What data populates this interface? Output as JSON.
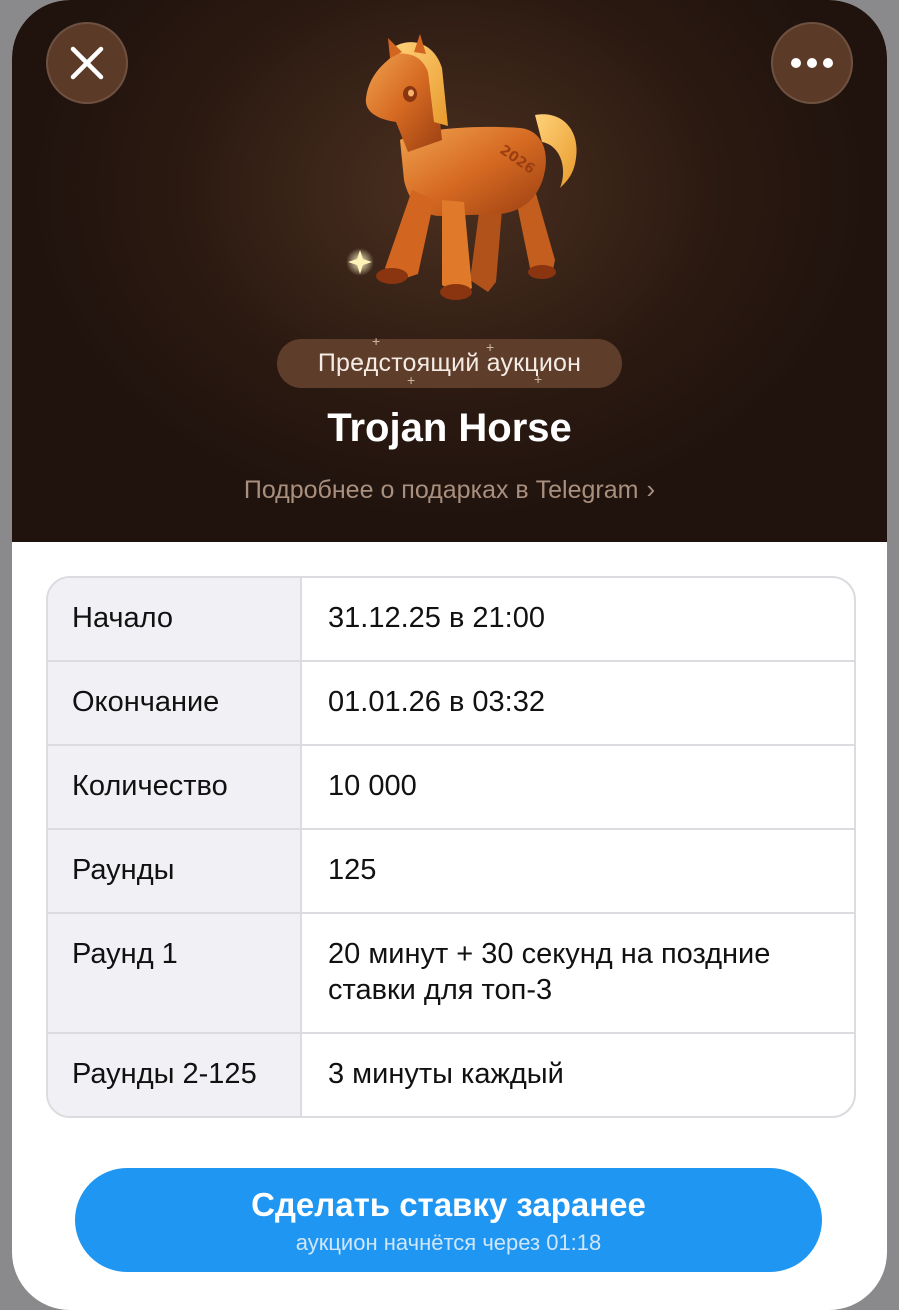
{
  "header": {
    "close_icon": "close-icon",
    "more_icon": "more-dots-icon",
    "gift_image": "trojan-horse-gift",
    "gift_engraving": "2026",
    "badge": "Предстоящий аукцион",
    "title": "Trojan Horse",
    "more_link": "Подробнее о подарках в Telegram",
    "more_link_icon": "chevron-right-icon"
  },
  "auction_details": [
    {
      "label": "Начало",
      "value": "31.12.25 в 21:00"
    },
    {
      "label": "Окончание",
      "value": "01.01.26 в 03:32"
    },
    {
      "label": "Количество",
      "value": "10 000"
    },
    {
      "label": "Раунды",
      "value": "125"
    },
    {
      "label": "Раунд 1",
      "value": "20 минут + 30 секунд на поздние ставки для топ-3"
    },
    {
      "label": "Раунды 2-125",
      "value": "3 минуты каждый"
    }
  ],
  "bid_button": {
    "label": "Сделать ставку заранее",
    "subtitle": "аукцион начнётся через 01:18"
  },
  "colors": {
    "header_background": "#2a1911",
    "badge_background": "#5e3e2b",
    "primary_button": "#1e96f2",
    "label_cell_background": "#f1f1f5"
  }
}
